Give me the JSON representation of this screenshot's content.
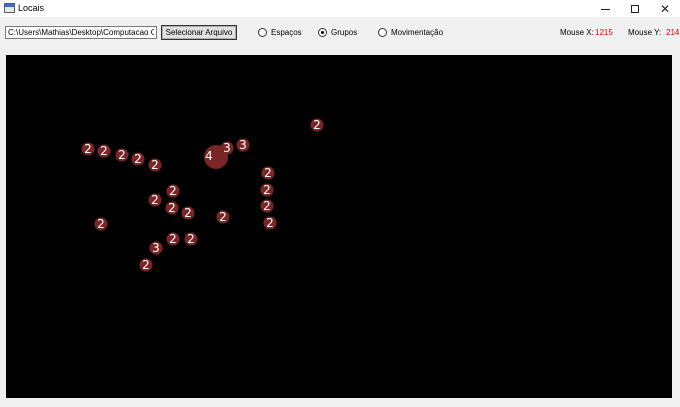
{
  "window": {
    "title": "Locais",
    "minimize": "—",
    "close": "✕"
  },
  "toolbar": {
    "path_value": "C:\\Users\\Mathias\\Desktop\\Computacao Grafic",
    "select_label": "Selecionar Arquivo",
    "radios": [
      {
        "label": "Espaços",
        "checked": false
      },
      {
        "label": "Grupos",
        "checked": true
      },
      {
        "label": "Movimentação",
        "checked": false
      }
    ],
    "mouse_x_label": "Mouse X:",
    "mouse_x_value": "1215",
    "mouse_y_label": "Mouse Y:",
    "mouse_y_value": "214"
  },
  "canvas": {
    "background": "#000000",
    "marker_color": "#7a2626",
    "marker_text_color": "#ffffff",
    "groups": [
      {
        "label": "2",
        "size": "small"
      },
      {
        "label": "2",
        "size": "small"
      },
      {
        "label": "2",
        "size": "small"
      },
      {
        "label": "2",
        "size": "small"
      },
      {
        "label": "2",
        "size": "small"
      },
      {
        "label": "4",
        "size": "large"
      },
      {
        "label": "3",
        "size": "small"
      },
      {
        "label": "3",
        "size": "small"
      },
      {
        "label": "2",
        "size": "small"
      },
      {
        "label": "2",
        "size": "small"
      },
      {
        "label": "2",
        "size": "small"
      },
      {
        "label": "2",
        "size": "small"
      },
      {
        "label": "2",
        "size": "small"
      },
      {
        "label": "2",
        "size": "small"
      },
      {
        "label": "2",
        "size": "small"
      },
      {
        "label": "2",
        "size": "small"
      },
      {
        "label": "2",
        "size": "small"
      },
      {
        "label": "2",
        "size": "small"
      },
      {
        "label": "2",
        "size": "small"
      },
      {
        "label": "2",
        "size": "small"
      },
      {
        "label": "2",
        "size": "small"
      },
      {
        "label": "3",
        "size": "small"
      },
      {
        "label": "2",
        "size": "small"
      },
      {
        "label": "2",
        "size": "small"
      },
      {
        "label": "2",
        "size": "small"
      }
    ]
  }
}
